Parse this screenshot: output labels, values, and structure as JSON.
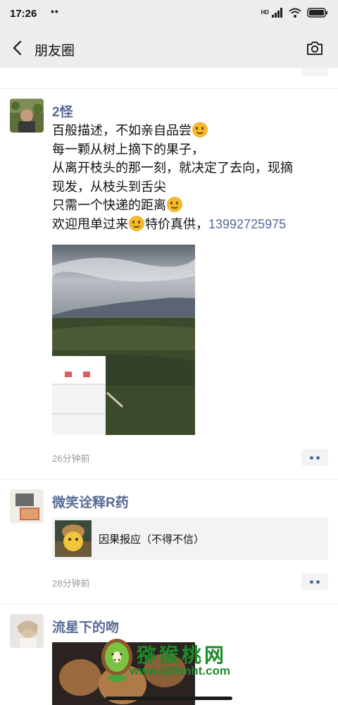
{
  "status_bar": {
    "time": "17:26",
    "dots": "••",
    "hd": "HD"
  },
  "header": {
    "title": "朋友圈",
    "back_icon": "chevron-left-icon",
    "camera_icon": "camera-icon"
  },
  "posts": [
    {
      "name": "2怪",
      "lines": [
        "百般描述，不如亲自品尝",
        "每一颗从树上摘下的果子，",
        "从离开枝头的那一刻，就决定了去向，现摘",
        "现发，从枝头到舌尖",
        "只需一个快递的距离",
        "欢迎甩单过来",
        "特价真供，",
        "13992725975"
      ],
      "time": "26分钟前"
    },
    {
      "name": "微笑诠释R药",
      "share_text": "因果报应（不得不信）",
      "time": "28分钟前"
    },
    {
      "name": "流星下的吻"
    }
  ],
  "watermark": {
    "zh": "猕猴桃网",
    "url": "www.029mht.com"
  },
  "colors": {
    "link": "#576b95",
    "bar_bg": "#ededed",
    "watermark": "#1e8a2a"
  }
}
